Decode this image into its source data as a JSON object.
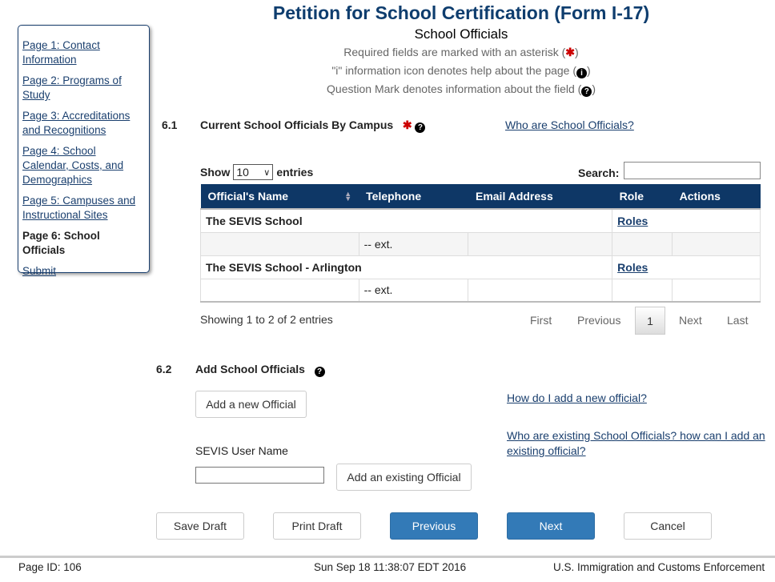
{
  "sidebar": {
    "items": [
      {
        "label": "Page 1: Contact Information"
      },
      {
        "label": "Page 2: Programs of Study"
      },
      {
        "label": "Page 3: Accreditations and Recognitions"
      },
      {
        "label": "Page 4: School Calendar, Costs, and Demographics"
      },
      {
        "label": "Page 5: Campuses and Instructional Sites"
      },
      {
        "label": "Page 6: School Officials",
        "current": true
      },
      {
        "label": "Submit"
      }
    ]
  },
  "header": {
    "title": "Petition for School Certification (Form I-17)",
    "subtitle": "School Officials",
    "note_required": "Required fields are marked with an asterisk (",
    "note_info": "\"i\" information icon denotes help about the page (",
    "note_question": "Question Mark denotes information about the field (",
    "close_paren": ")"
  },
  "section1": {
    "number": "6.1",
    "title": "Current School Officials By Campus",
    "help_link": "Who are School Officials?",
    "show_label": "Show",
    "entries_label": "entries",
    "page_size": "10",
    "search_label": "Search:",
    "search_value": "",
    "columns": [
      "Official's Name",
      "Telephone",
      "Email Address",
      "Role",
      "Actions"
    ],
    "rows": [
      {
        "campus": "The SEVIS School",
        "role_link": "Roles",
        "telephone": "-- ext."
      },
      {
        "campus": "The SEVIS School - Arlington",
        "role_link": "Roles",
        "telephone": "-- ext."
      }
    ],
    "info": "Showing 1 to 2 of 2 entries",
    "pagination": {
      "first": "First",
      "previous": "Previous",
      "current": "1",
      "next": "Next",
      "last": "Last"
    }
  },
  "section2": {
    "number": "6.2",
    "title": "Add School Officials",
    "add_new": "Add a new Official",
    "username_label": "SEVIS User Name",
    "username_value": "",
    "add_existing": "Add an existing Official",
    "link1": "How do I add a new official?",
    "link2": "Who are existing School Officials? how can I add an existing official?"
  },
  "actions": {
    "save": "Save Draft",
    "print": "Print Draft",
    "previous": "Previous",
    "next": "Next",
    "cancel": "Cancel"
  },
  "footer": {
    "page_id": "Page ID: 106",
    "timestamp": "Sun Sep 18 11:38:07 EDT 2016",
    "agency": "U.S. Immigration and Customs Enforcement"
  },
  "colors": {
    "title": "#0e3d6e",
    "table_header": "#0e3766",
    "primary_button": "#337ab7",
    "asterisk": "#cc0000"
  }
}
